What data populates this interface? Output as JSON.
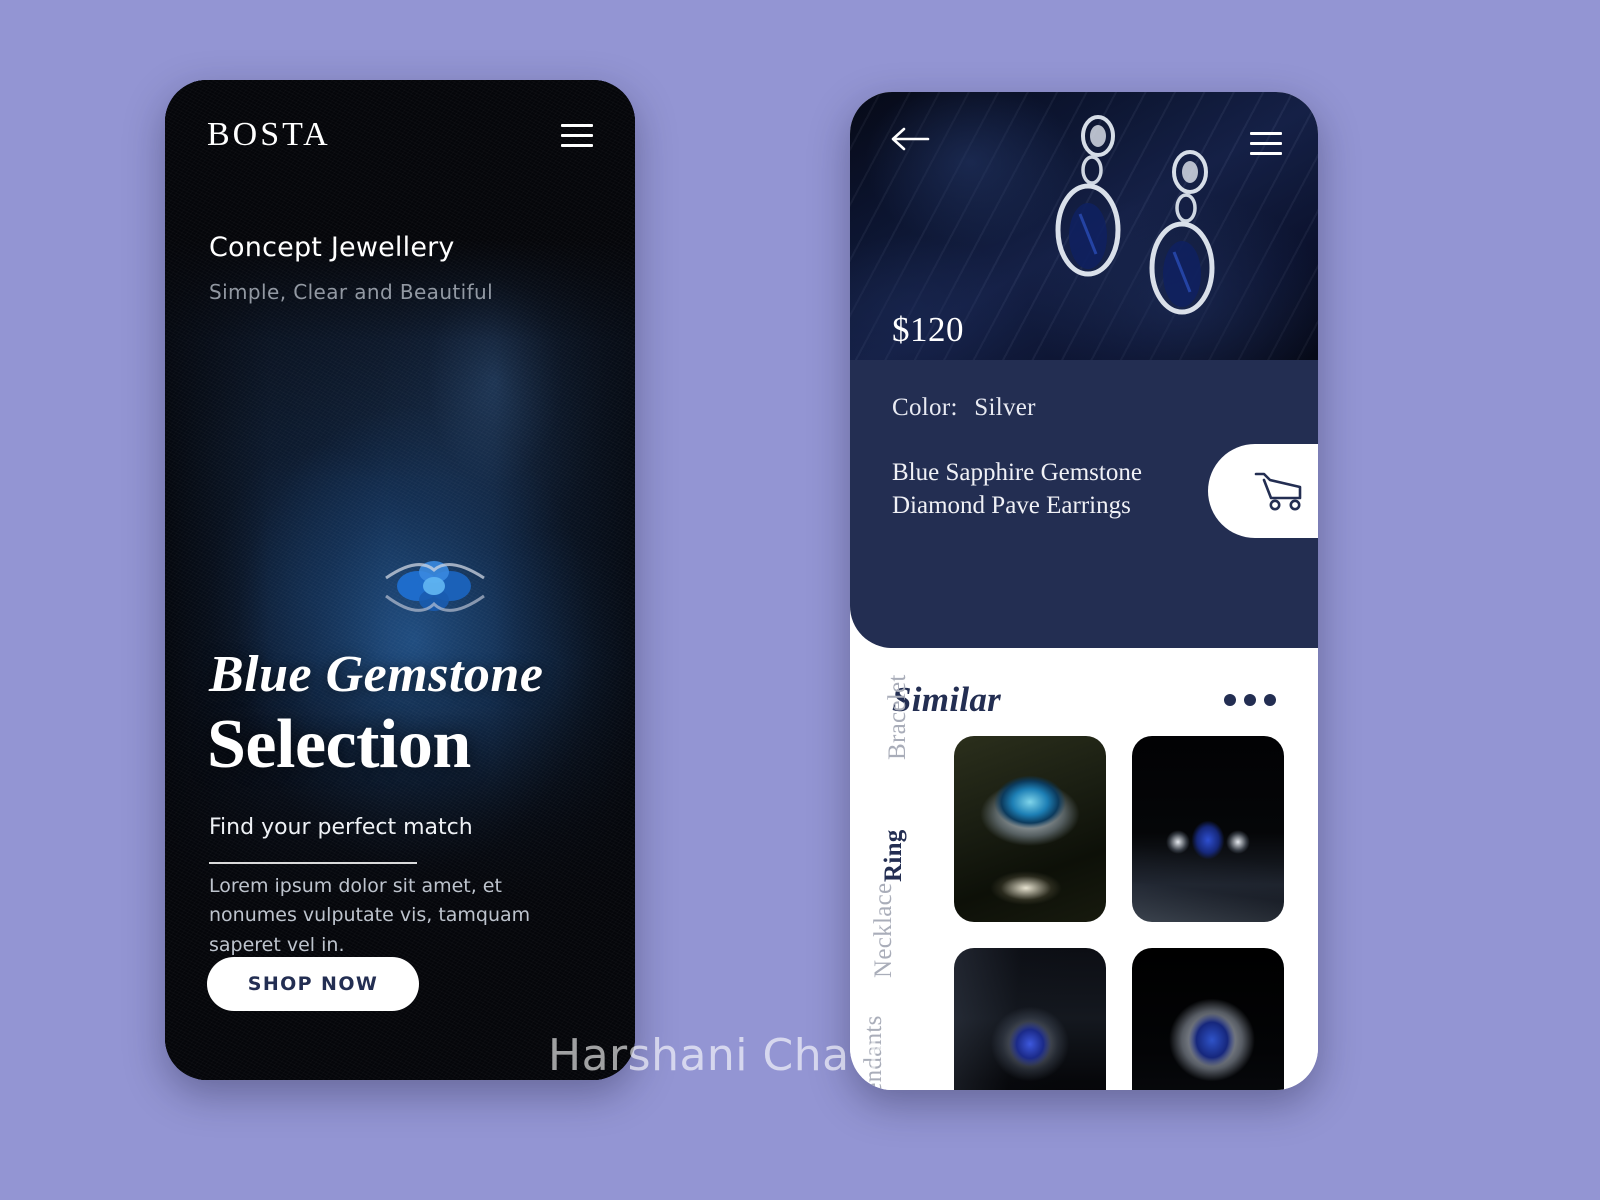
{
  "theme": {
    "background": "#9395d3",
    "navy": "#232e52",
    "white": "#ffffff",
    "muted_category": "#a9adb9"
  },
  "watermark": {
    "text": "Harshani Chath"
  },
  "left_screen": {
    "brand": "BOSTA",
    "menu_icon": "hamburger-icon",
    "concept_title": "Concept Jewellery",
    "concept_subtitle": "Simple, Clear and Beautiful",
    "headline_italic": "Blue Gemstone",
    "headline_bold": "Selection",
    "tagline": "Find your perfect match",
    "paragraph": "Lorem ipsum dolor sit amet, et nonumes vulputate vis, tamquam saperet vel in.",
    "cta_label": "SHOP NOW"
  },
  "right_screen": {
    "back_icon": "arrow-left-icon",
    "menu_icon": "hamburger-icon",
    "price": "$120",
    "color_label": "Color:",
    "color_value": "Silver",
    "product_title": "Blue Sapphire Gemstone Diamond Pave Earrings",
    "cart_icon": "shopping-cart-icon",
    "similar": {
      "title": "Similar",
      "more_icon": "more-dots-icon",
      "categories": [
        {
          "label": "Bracelet",
          "active": false
        },
        {
          "label": "Ring",
          "active": true
        },
        {
          "label": "Necklace",
          "active": false
        },
        {
          "label": "Pendants",
          "active": false
        }
      ],
      "items": [
        {
          "name": "aquamarine-halo-ring"
        },
        {
          "name": "sapphire-three-stone-ring"
        },
        {
          "name": "blue-sapphire-halo-ring"
        },
        {
          "name": "sapphire-diamond-cluster-ring"
        }
      ]
    }
  }
}
